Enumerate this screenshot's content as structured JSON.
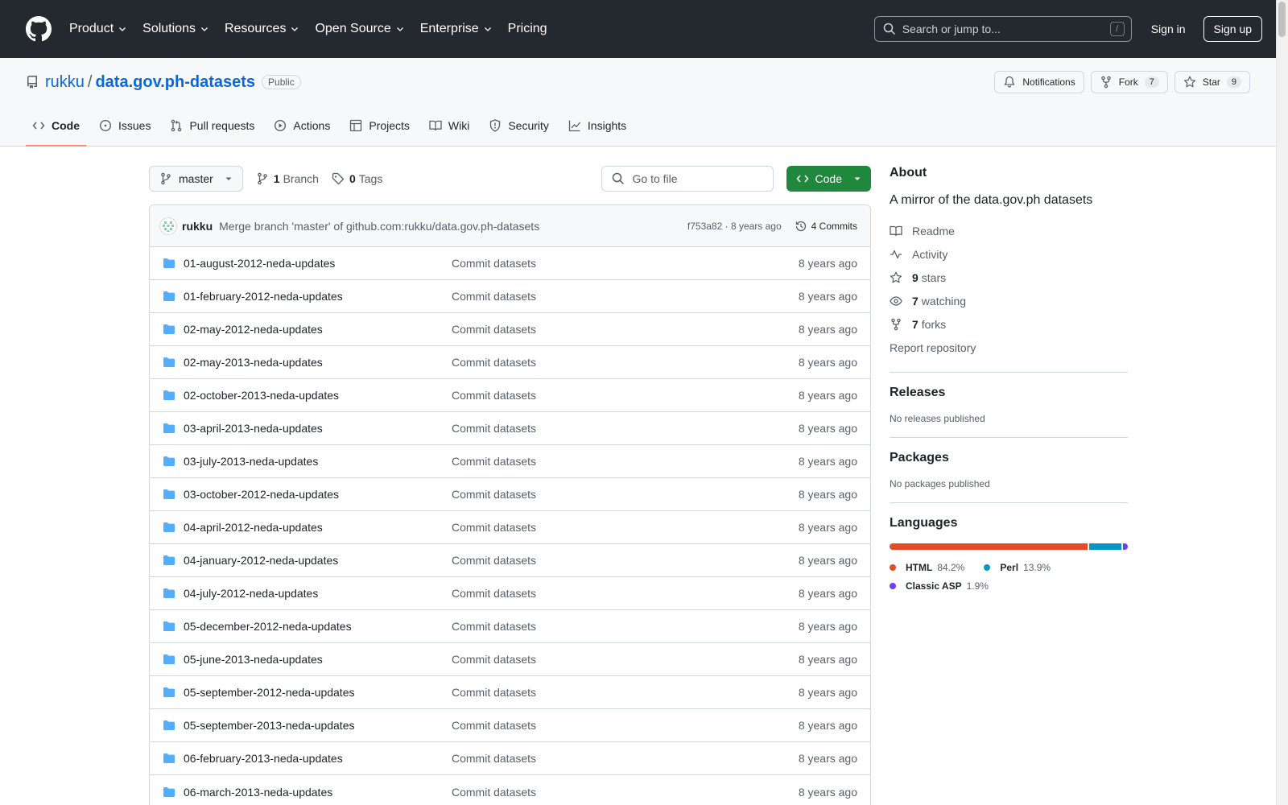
{
  "topnav": {
    "items": [
      "Product",
      "Solutions",
      "Resources",
      "Open Source",
      "Enterprise",
      "Pricing"
    ],
    "search_placeholder": "Search or jump to...",
    "search_key": "/",
    "signin": "Sign in",
    "signup": "Sign up"
  },
  "repo": {
    "owner": "rukku",
    "separator": "/",
    "name": "data.gov.ph-datasets",
    "visibility": "Public",
    "notifications_label": "Notifications",
    "fork_label": "Fork",
    "fork_count": "7",
    "star_label": "Star",
    "star_count": "9"
  },
  "reponav": {
    "tabs": [
      {
        "label": "Code",
        "icon": "code-icon"
      },
      {
        "label": "Issues",
        "icon": "issue-icon"
      },
      {
        "label": "Pull requests",
        "icon": "pull-request-icon"
      },
      {
        "label": "Actions",
        "icon": "play-icon"
      },
      {
        "label": "Projects",
        "icon": "table-icon"
      },
      {
        "label": "Wiki",
        "icon": "book-icon"
      },
      {
        "label": "Security",
        "icon": "shield-icon"
      },
      {
        "label": "Insights",
        "icon": "graph-icon"
      }
    ],
    "active": "Code"
  },
  "toolbar": {
    "branch": "master",
    "branch_count": "1",
    "branch_label": "Branch",
    "tag_count": "0",
    "tag_label": "Tags",
    "goto_placeholder": "Go to file",
    "code_button": "Code"
  },
  "commit": {
    "author": "rukku",
    "message": "Merge branch 'master' of github.com:rukku/data.gov.ph-datasets",
    "sha_time": "f753a82 · 8 years ago",
    "commits_count": "4 Commits"
  },
  "files": [
    {
      "name": "01-august-2012-neda-updates",
      "commit": "Commit datasets",
      "date": "8 years ago"
    },
    {
      "name": "01-february-2012-neda-updates",
      "commit": "Commit datasets",
      "date": "8 years ago"
    },
    {
      "name": "02-may-2012-neda-updates",
      "commit": "Commit datasets",
      "date": "8 years ago"
    },
    {
      "name": "02-may-2013-neda-updates",
      "commit": "Commit datasets",
      "date": "8 years ago"
    },
    {
      "name": "02-october-2013-neda-updates",
      "commit": "Commit datasets",
      "date": "8 years ago"
    },
    {
      "name": "03-april-2013-neda-updates",
      "commit": "Commit datasets",
      "date": "8 years ago"
    },
    {
      "name": "03-july-2013-neda-updates",
      "commit": "Commit datasets",
      "date": "8 years ago"
    },
    {
      "name": "03-october-2012-neda-updates",
      "commit": "Commit datasets",
      "date": "8 years ago"
    },
    {
      "name": "04-april-2012-neda-updates",
      "commit": "Commit datasets",
      "date": "8 years ago"
    },
    {
      "name": "04-january-2012-neda-updates",
      "commit": "Commit datasets",
      "date": "8 years ago"
    },
    {
      "name": "04-july-2012-neda-updates",
      "commit": "Commit datasets",
      "date": "8 years ago"
    },
    {
      "name": "05-december-2012-neda-updates",
      "commit": "Commit datasets",
      "date": "8 years ago"
    },
    {
      "name": "05-june-2013-neda-updates",
      "commit": "Commit datasets",
      "date": "8 years ago"
    },
    {
      "name": "05-september-2012-neda-updates",
      "commit": "Commit datasets",
      "date": "8 years ago"
    },
    {
      "name": "05-september-2013-neda-updates",
      "commit": "Commit datasets",
      "date": "8 years ago"
    },
    {
      "name": "06-february-2013-neda-updates",
      "commit": "Commit datasets",
      "date": "8 years ago"
    },
    {
      "name": "06-march-2013-neda-updates",
      "commit": "Commit datasets",
      "date": "8 years ago"
    }
  ],
  "about": {
    "title": "About",
    "description": "A mirror of the data.gov.ph datasets",
    "readme": "Readme",
    "activity": "Activity",
    "stars_count": "9",
    "stars_label": "stars",
    "watching_count": "7",
    "watching_label": "watching",
    "forks_count": "7",
    "forks_label": "forks",
    "report": "Report repository"
  },
  "releases": {
    "title": "Releases",
    "empty": "No releases published"
  },
  "packages": {
    "title": "Packages",
    "empty": "No packages published"
  },
  "languages": {
    "title": "Languages",
    "items": [
      {
        "name": "HTML",
        "percent": 84.2,
        "label": "84.2%",
        "color": "#e34c26"
      },
      {
        "name": "Perl",
        "percent": 13.9,
        "label": "13.9%",
        "color": "#0298c3"
      },
      {
        "name": "Classic ASP",
        "percent": 1.9,
        "label": "1.9%",
        "color": "#6a40fd"
      }
    ]
  },
  "colors": {
    "header_bg": "#24292f",
    "link": "#0969da",
    "code_button": "#1f883d",
    "active_tab_underline": "#fd8c73",
    "folder": "#54aeff"
  }
}
